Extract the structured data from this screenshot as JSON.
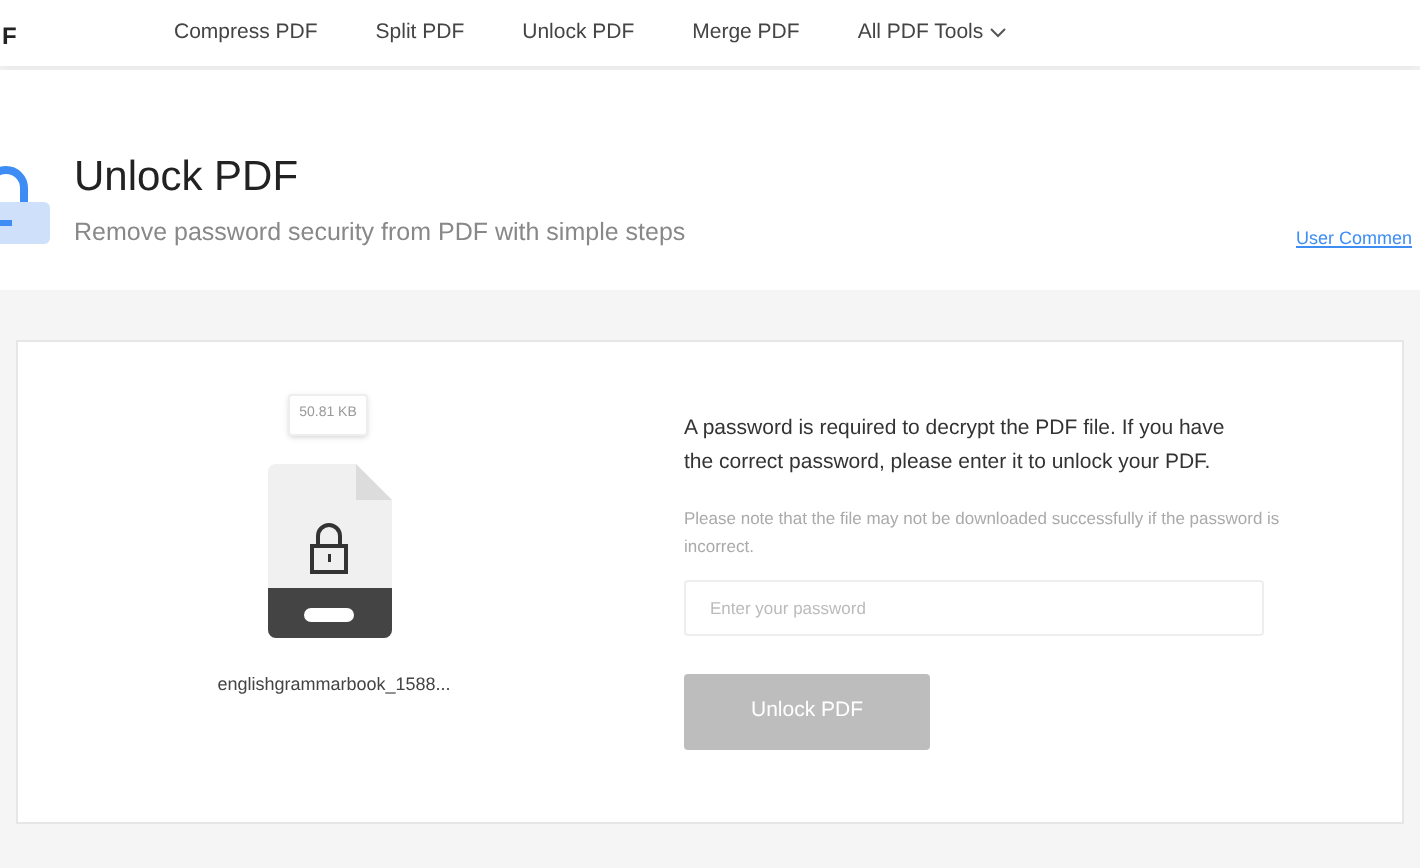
{
  "logo_text": "F",
  "nav": [
    {
      "label": "Compress PDF",
      "kind": "link"
    },
    {
      "label": "Split PDF",
      "kind": "link"
    },
    {
      "label": "Unlock PDF",
      "kind": "link"
    },
    {
      "label": "Merge PDF",
      "kind": "link"
    },
    {
      "label": "All PDF Tools",
      "kind": "dropdown"
    }
  ],
  "header": {
    "title": "Unlock PDF",
    "subtitle": "Remove password security from PDF with simple steps",
    "link": "User Commen"
  },
  "file": {
    "size": "50.81 KB",
    "name": "englishgrammarbook_1588..."
  },
  "form": {
    "message": "A password is required to decrypt the PDF file. If you have the correct password, please enter it to unlock your PDF.",
    "note": "Please note that the file may not be downloaded successfully if the password is incorrect.",
    "password": {
      "placeholder": "Enter your password"
    },
    "button": {
      "label": "Unlock PDF",
      "disabled": true
    }
  }
}
